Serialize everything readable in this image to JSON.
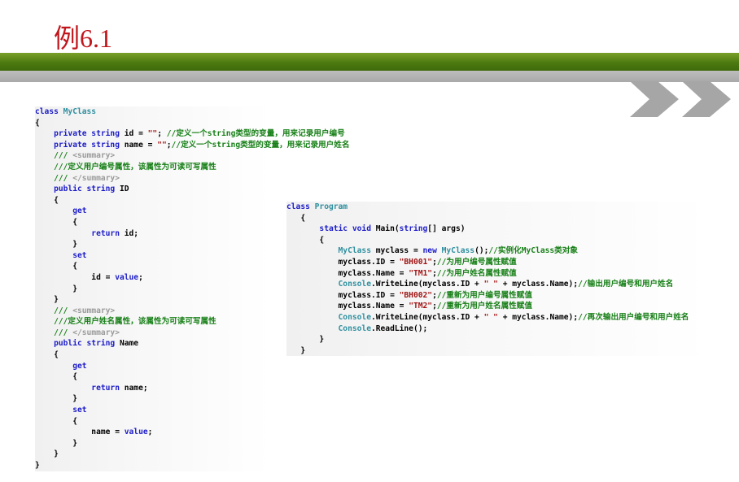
{
  "slide": {
    "title": "例6.1"
  },
  "code_left": [
    [
      {
        "t": "class ",
        "c": "kw"
      },
      {
        "t": "MyClass",
        "c": "ty"
      }
    ],
    [
      {
        "t": "{",
        "c": ""
      }
    ],
    [
      {
        "t": "    private string ",
        "c": "kw"
      },
      {
        "t": "id = ",
        "c": ""
      },
      {
        "t": "\"\"",
        "c": "st"
      },
      {
        "t": "; ",
        "c": ""
      },
      {
        "t": "//定义一个string类型的变量，用来记录用户编号",
        "c": "cm"
      }
    ],
    [
      {
        "t": "    private string ",
        "c": "kw"
      },
      {
        "t": "name = ",
        "c": ""
      },
      {
        "t": "\"\"",
        "c": "st"
      },
      {
        "t": ";",
        "c": ""
      },
      {
        "t": "//定义一个string类型的变量，用来记录用户姓名",
        "c": "cm"
      }
    ],
    [
      {
        "t": "    /// ",
        "c": "cm"
      },
      {
        "t": "<summary>",
        "c": "gr"
      }
    ],
    [
      {
        "t": "    ///定义用户编号属性，该属性为可读可写属性",
        "c": "cm"
      }
    ],
    [
      {
        "t": "    /// ",
        "c": "cm"
      },
      {
        "t": "</summary>",
        "c": "gr"
      }
    ],
    [
      {
        "t": "    public string ",
        "c": "kw"
      },
      {
        "t": "ID",
        "c": ""
      }
    ],
    [
      {
        "t": "    {",
        "c": ""
      }
    ],
    [
      {
        "t": "        get",
        "c": "kw"
      }
    ],
    [
      {
        "t": "        {",
        "c": ""
      }
    ],
    [
      {
        "t": "            return ",
        "c": "kw"
      },
      {
        "t": "id;",
        "c": ""
      }
    ],
    [
      {
        "t": "        }",
        "c": ""
      }
    ],
    [
      {
        "t": "        set",
        "c": "kw"
      }
    ],
    [
      {
        "t": "        {",
        "c": ""
      }
    ],
    [
      {
        "t": "            id = ",
        "c": ""
      },
      {
        "t": "value",
        "c": "kw"
      },
      {
        "t": ";",
        "c": ""
      }
    ],
    [
      {
        "t": "        }",
        "c": ""
      }
    ],
    [
      {
        "t": "    }",
        "c": ""
      }
    ],
    [
      {
        "t": "    /// ",
        "c": "cm"
      },
      {
        "t": "<summary>",
        "c": "gr"
      }
    ],
    [
      {
        "t": "    ///定义用户姓名属性，该属性为可读可写属性",
        "c": "cm"
      }
    ],
    [
      {
        "t": "    /// ",
        "c": "cm"
      },
      {
        "t": "</summary>",
        "c": "gr"
      }
    ],
    [
      {
        "t": "    public string ",
        "c": "kw"
      },
      {
        "t": "Name",
        "c": ""
      }
    ],
    [
      {
        "t": "    {",
        "c": ""
      }
    ],
    [
      {
        "t": "        get",
        "c": "kw"
      }
    ],
    [
      {
        "t": "        {",
        "c": ""
      }
    ],
    [
      {
        "t": "            return ",
        "c": "kw"
      },
      {
        "t": "name;",
        "c": ""
      }
    ],
    [
      {
        "t": "        }",
        "c": ""
      }
    ],
    [
      {
        "t": "        set",
        "c": "kw"
      }
    ],
    [
      {
        "t": "        {",
        "c": ""
      }
    ],
    [
      {
        "t": "            name = ",
        "c": ""
      },
      {
        "t": "value",
        "c": "kw"
      },
      {
        "t": ";",
        "c": ""
      }
    ],
    [
      {
        "t": "        }",
        "c": ""
      }
    ],
    [
      {
        "t": "    }",
        "c": ""
      }
    ],
    [
      {
        "t": "}",
        "c": ""
      }
    ]
  ],
  "code_right": [
    [
      {
        "t": "class ",
        "c": "kw"
      },
      {
        "t": "Program",
        "c": "ty"
      }
    ],
    [
      {
        "t": "   {",
        "c": ""
      }
    ],
    [
      {
        "t": "       static void ",
        "c": "kw"
      },
      {
        "t": "Main(",
        "c": ""
      },
      {
        "t": "string",
        "c": "kw"
      },
      {
        "t": "[] args)",
        "c": ""
      }
    ],
    [
      {
        "t": "       {",
        "c": ""
      }
    ],
    [
      {
        "t": "           MyClass ",
        "c": "ty"
      },
      {
        "t": "myclass = ",
        "c": ""
      },
      {
        "t": "new ",
        "c": "kw"
      },
      {
        "t": "MyClass",
        "c": "ty"
      },
      {
        "t": "();",
        "c": ""
      },
      {
        "t": "//实例化MyClass类对象",
        "c": "cm"
      }
    ],
    [
      {
        "t": "           myclass.ID = ",
        "c": ""
      },
      {
        "t": "\"BH001\"",
        "c": "st"
      },
      {
        "t": ";",
        "c": ""
      },
      {
        "t": "//为用户编号属性赋值",
        "c": "cm"
      }
    ],
    [
      {
        "t": "           myclass.Name = ",
        "c": ""
      },
      {
        "t": "\"TM1\"",
        "c": "st"
      },
      {
        "t": ";",
        "c": ""
      },
      {
        "t": "//为用户姓名属性赋值",
        "c": "cm"
      }
    ],
    [
      {
        "t": "           Console",
        "c": "ty"
      },
      {
        "t": ".WriteLine(myclass.ID + ",
        "c": ""
      },
      {
        "t": "\" \"",
        "c": "st"
      },
      {
        "t": " + myclass.Name);",
        "c": ""
      },
      {
        "t": "//输出用户编号和用户姓名",
        "c": "cm"
      }
    ],
    [
      {
        "t": "           myclass.ID = ",
        "c": ""
      },
      {
        "t": "\"BH002\"",
        "c": "st"
      },
      {
        "t": ";",
        "c": ""
      },
      {
        "t": "//重新为用户编号属性赋值",
        "c": "cm"
      }
    ],
    [
      {
        "t": "           myclass.Name = ",
        "c": ""
      },
      {
        "t": "\"TM2\"",
        "c": "st"
      },
      {
        "t": ";",
        "c": ""
      },
      {
        "t": "//重新为用户姓名属性赋值",
        "c": "cm"
      }
    ],
    [
      {
        "t": "           Console",
        "c": "ty"
      },
      {
        "t": ".WriteLine(myclass.ID + ",
        "c": ""
      },
      {
        "t": "\" \"",
        "c": "st"
      },
      {
        "t": " + myclass.Name);",
        "c": ""
      },
      {
        "t": "//再次输出用户编号和用户姓名",
        "c": "cm"
      }
    ],
    [
      {
        "t": "           Console",
        "c": "ty"
      },
      {
        "t": ".ReadLine();",
        "c": ""
      }
    ],
    [
      {
        "t": "       }",
        "c": ""
      }
    ],
    [
      {
        "t": "   }",
        "c": ""
      }
    ]
  ],
  "colors": {
    "title": "#c0161c",
    "keyword": "#1c1cc8",
    "type": "#2f8f9f",
    "comment": "#188018",
    "string": "#a31515",
    "header_green": "#4d7a10",
    "header_gray": "#a9a9a9"
  },
  "icons": [
    "chevron-right-icon",
    "chevron-right-icon"
  ]
}
